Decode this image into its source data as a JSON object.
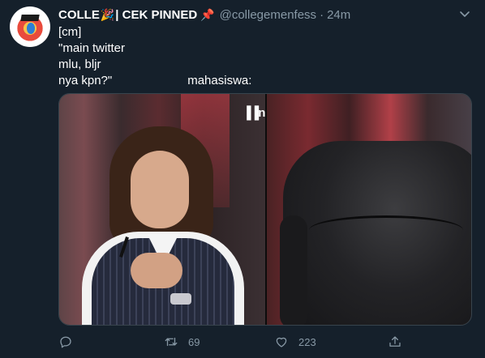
{
  "tweet": {
    "author_name": "COLLE",
    "author_name_suffix": "| CEK PINNED",
    "party_emoji": "🎉",
    "pin_emoji": "📌",
    "handle": "@collegemenfess",
    "separator": "·",
    "time": "24m",
    "lines": [
      "[cm]",
      "\"main twitter",
      "mlu, bljr",
      "nya kpn?\""
    ],
    "line4_tail": "mahasiswa:",
    "media_logo_text": "n",
    "media_logo_mark": "▐▐"
  },
  "actions": {
    "reply": {
      "icon": "reply-icon",
      "count": ""
    },
    "retweet": {
      "icon": "retweet-icon",
      "count": "69"
    },
    "like": {
      "icon": "heart-icon",
      "count": "223"
    },
    "share": {
      "icon": "share-icon",
      "count": ""
    }
  },
  "colors": {
    "background": "#15202b",
    "muted": "#8899a6",
    "text": "#ffffff"
  }
}
